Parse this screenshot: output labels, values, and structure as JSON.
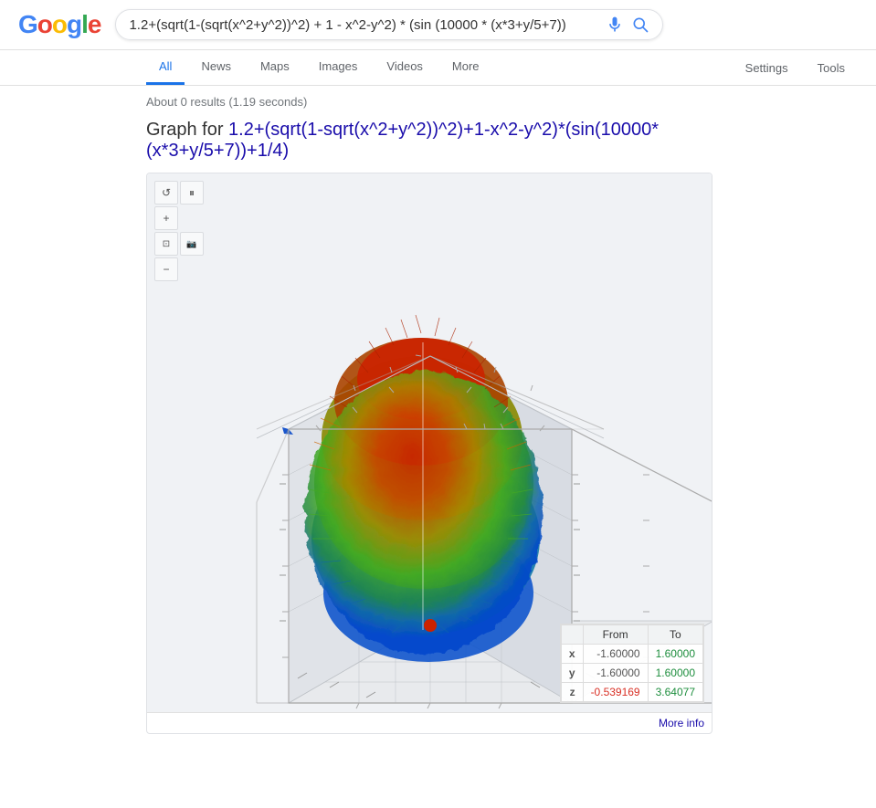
{
  "header": {
    "logo": "Google",
    "search_query": "1.2+(sqrt(1-(sqrt(x^2+y^2))^2) + 1 - x^2-y^2) * (sin (10000 * (x*3+y/5+7))",
    "mic_label": "Search by voice",
    "search_label": "Google Search"
  },
  "nav": {
    "items": [
      {
        "label": "All",
        "active": true
      },
      {
        "label": "News",
        "active": false
      },
      {
        "label": "Maps",
        "active": false
      },
      {
        "label": "Images",
        "active": false
      },
      {
        "label": "Videos",
        "active": false
      },
      {
        "label": "More",
        "active": false
      }
    ],
    "right_items": [
      {
        "label": "Settings"
      },
      {
        "label": "Tools"
      }
    ]
  },
  "results": {
    "count_text": "About 0 results (1.19 seconds)",
    "graph_label": "Graph for ",
    "graph_formula": "1.2+(sqrt(1-sqrt(x^2+y^2))^2)+1-x^2-y^2)*(sin(10000*(x*3+y/5+7))+1/4)"
  },
  "controls": {
    "rotate_icon": "↺",
    "pause_icon": "⏸",
    "zoom_in_icon": "+",
    "fit_icon": "⊡",
    "zoom_out_icon": "−"
  },
  "range_table": {
    "header_blank": "",
    "header_from": "From",
    "header_to": "To",
    "rows": [
      {
        "label": "x",
        "from": "-1.60000",
        "to": "1.60000"
      },
      {
        "label": "y",
        "from": "-1.60000",
        "to": "1.60000"
      },
      {
        "label": "z",
        "from": "-0.539169",
        "to": "3.64077"
      }
    ]
  },
  "more_info": "More info",
  "colors": {
    "accent_blue": "#1a0dab",
    "google_blue": "#4285F4",
    "google_red": "#EA4335",
    "google_yellow": "#FBBC05",
    "google_green": "#34A853"
  }
}
